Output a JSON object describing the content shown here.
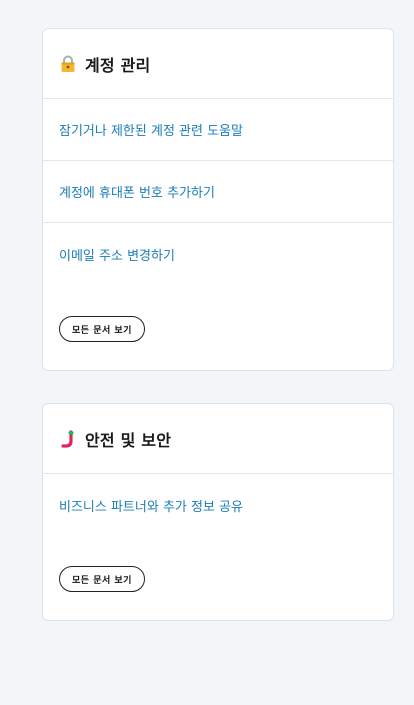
{
  "sections": [
    {
      "title": "계정 관리",
      "icon": "lock-icon",
      "links": [
        "잠기거나 제한된 계정 관련 도움말",
        "계정에 휴대폰 번호 추가하기",
        "이메일 주소 변경하기"
      ],
      "view_all_label": "모든 문서 보기"
    },
    {
      "title": "안전 및 보안",
      "icon": "safety-icon",
      "links": [
        "비즈니스 파트너와 추가 정보 공유"
      ],
      "view_all_label": "모든 문서 보기"
    }
  ],
  "colors": {
    "link": "#1b7db8",
    "background": "#f3f6f9",
    "lock_body": "#f5b731",
    "safety_red": "#e0245e",
    "safety_green": "#17bf63"
  }
}
